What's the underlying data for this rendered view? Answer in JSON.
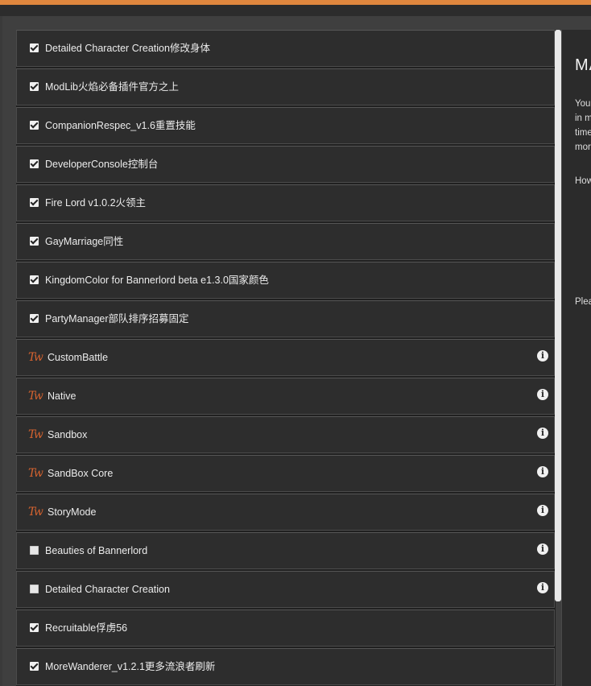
{
  "mods": [
    {
      "label": "Detailed Character Creation修改身体",
      "kind": "checkbox",
      "checked": true,
      "info": false
    },
    {
      "label": "ModLib火焰必备插件官方之上",
      "kind": "checkbox",
      "checked": true,
      "info": false
    },
    {
      "label": "CompanionRespec_v1.6重置技能",
      "kind": "checkbox",
      "checked": true,
      "info": false
    },
    {
      "label": "DeveloperConsole控制台",
      "kind": "checkbox",
      "checked": true,
      "info": false
    },
    {
      "label": "Fire Lord v1.0.2火领主",
      "kind": "checkbox",
      "checked": true,
      "info": false
    },
    {
      "label": "GayMarriage同性",
      "kind": "checkbox",
      "checked": true,
      "info": false
    },
    {
      "label": "KingdomColor for Bannerlord beta e1.3.0国家颜色",
      "kind": "checkbox",
      "checked": true,
      "info": false
    },
    {
      "label": "PartyManager部队排序招募固定",
      "kind": "checkbox",
      "checked": true,
      "info": false
    },
    {
      "label": "CustomBattle",
      "kind": "native",
      "checked": true,
      "info": true
    },
    {
      "label": "Native",
      "kind": "native",
      "checked": true,
      "info": true
    },
    {
      "label": "Sandbox",
      "kind": "native",
      "checked": true,
      "info": true
    },
    {
      "label": "SandBox Core",
      "kind": "native",
      "checked": true,
      "info": true
    },
    {
      "label": "StoryMode",
      "kind": "native",
      "checked": true,
      "info": true
    },
    {
      "label": "Beauties of Bannerlord",
      "kind": "checkbox",
      "checked": false,
      "info": true
    },
    {
      "label": "Detailed Character Creation",
      "kind": "checkbox",
      "checked": false,
      "info": true
    },
    {
      "label": "Recruitable俘虏56",
      "kind": "checkbox",
      "checked": true,
      "info": false
    },
    {
      "label": "MoreWanderer_v1.2.1更多流浪者刷新",
      "kind": "checkbox",
      "checked": true,
      "info": false
    }
  ],
  "icons": {
    "native": "tw-logo-icon",
    "info": "info-icon",
    "check": "checkbox-icon"
  },
  "detail": {
    "title": "MA",
    "lines": [
      "You",
      "in m",
      "time",
      "mor",
      "How",
      "Plea"
    ]
  },
  "colors": {
    "accent": "#e0873e",
    "tw_logo": "#d6632f"
  }
}
